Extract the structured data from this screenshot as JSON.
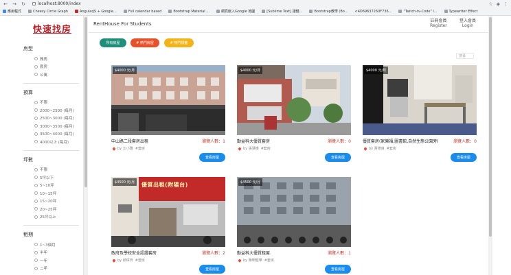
{
  "browser": {
    "url": "localhost:8000/index",
    "bookmarks": [
      "應用程式",
      "Cheesy Circle Graph",
      "AngularJS + Google...",
      "Full calendar based",
      "Bootstrap Material ...",
      "網頁嵌入Google 地圖",
      "[Sublime Text] 讓鍵...",
      "Bootstrap教學 (Bo...",
      "<4D69637260F736...",
      "\"Twitch-tv-Code\" l...",
      "Typewriter Effect"
    ]
  },
  "sidebar": {
    "logo": "快速找房",
    "sections": [
      {
        "title": "房型",
        "options": [
          "雅房",
          "套房",
          "公寓"
        ]
      },
      {
        "title": "預算",
        "options": [
          "不限",
          "2000~2500 (每月)",
          "2500~3000 (每月)",
          "3000~3500 (每月)",
          "3500~4000 (每月)",
          "4000以上 (每月)"
        ]
      },
      {
        "title": "坪數",
        "options": [
          "不限",
          "5坪以下",
          "5~10坪",
          "10~15坪",
          "15~20坪",
          "20~25坪",
          "25坪以上"
        ]
      },
      {
        "title": "租期",
        "options": [
          "1~3個月",
          "半年",
          "一年",
          "二年"
        ]
      }
    ]
  },
  "header": {
    "title": "RentHouse For Students",
    "register_top": "註冊會員",
    "register": "Register",
    "login_top": "登入會員",
    "login": "Login"
  },
  "filters": {
    "all": "所有房屋",
    "hot_area": "# 熱門房屋",
    "hot_label": "# 熱門標籤",
    "colors": {
      "all": "#1f8f7a",
      "hot_area": "#e8502a",
      "hot_label": "#f2b418"
    }
  },
  "search": {
    "placeholder": "搜尋"
  },
  "cards": [
    {
      "price": "$4000 元/月",
      "title": "中山路二段套房出租",
      "viewers": "瀏覽人數：1",
      "owner": "by 江小雅",
      "tag": "#套房",
      "button": "查看房屋"
    },
    {
      "price": "$4000 元/月",
      "title": "勤益科大優質套房",
      "viewers": "瀏覽人數：0",
      "owner": "by 張慧榛",
      "tag": "#套房",
      "button": "查看房屋"
    },
    {
      "price": "$4000 元/月",
      "title": "優質套房(家樂福,圖書館,自然生態公園旁)",
      "viewers": "瀏覽人數：0",
      "owner": "by 賈德良",
      "tag": "#套房",
      "button": "查看房屋"
    },
    {
      "price": "$4500 元/月",
      "title": "政府及學校安全認證套房",
      "viewers": "瀏覽人數：2",
      "owner": "by 郝偉齊",
      "tag": "#套房",
      "button": "查看房屋",
      "sign": "優質出租(附陽台)"
    },
    {
      "price": "$4500 元/月",
      "title": "勤益科大優質租屋",
      "viewers": "瀏覽人數：1",
      "owner": "by 陳明健華",
      "tag": "#套房",
      "button": "查看房屋"
    }
  ]
}
